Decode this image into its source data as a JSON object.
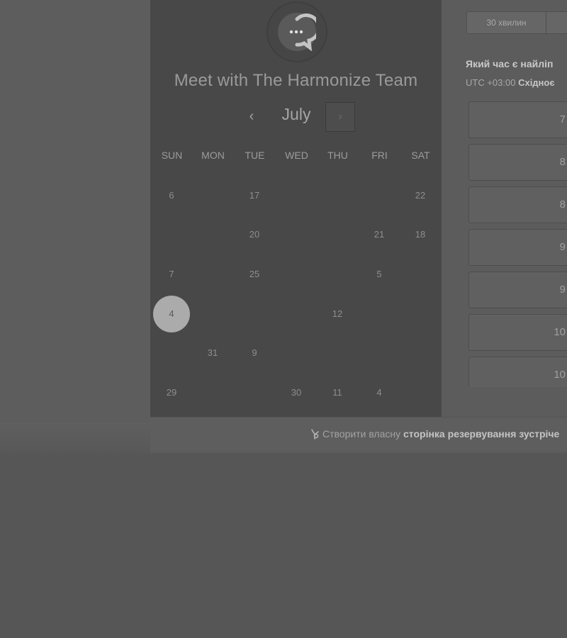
{
  "meeting": {
    "title": "Meet with The Harmonize Team",
    "logo_icon": "chat-bubble-dots-icon"
  },
  "calendar": {
    "month": "July",
    "prev_icon": "‹",
    "next_icon": "›",
    "weekdays": [
      "SUN",
      "MON",
      "TUE",
      "WED",
      "THU",
      "FRI",
      "SAT"
    ],
    "rows": [
      [
        "6",
        "",
        "17",
        "",
        "",
        "",
        "22"
      ],
      [
        "",
        "",
        "20",
        "",
        "",
        "21",
        "18"
      ],
      [
        "7",
        "",
        "25",
        "",
        "",
        "5",
        ""
      ],
      [
        "4",
        "",
        "",
        "",
        "12",
        "",
        ""
      ],
      [
        "",
        "31",
        "9",
        "",
        "",
        "",
        ""
      ],
      [
        "29",
        "",
        "",
        "30",
        "11",
        "4",
        ""
      ]
    ],
    "selected_day": "4"
  },
  "booking": {
    "duration_options": [
      "30 хвилин"
    ],
    "question": "Який час є найліп",
    "timezone_prefix": "UTC +03:00",
    "timezone_name": "Східноє",
    "slots": [
      "7",
      "8",
      "8",
      "9",
      "9",
      "10",
      "10"
    ]
  },
  "footer": {
    "prefix": "Створити власну",
    "link": "сторінка резервування зустріче"
  },
  "colors": {
    "left_panel": "#484848",
    "selected_day": "#ababab"
  }
}
